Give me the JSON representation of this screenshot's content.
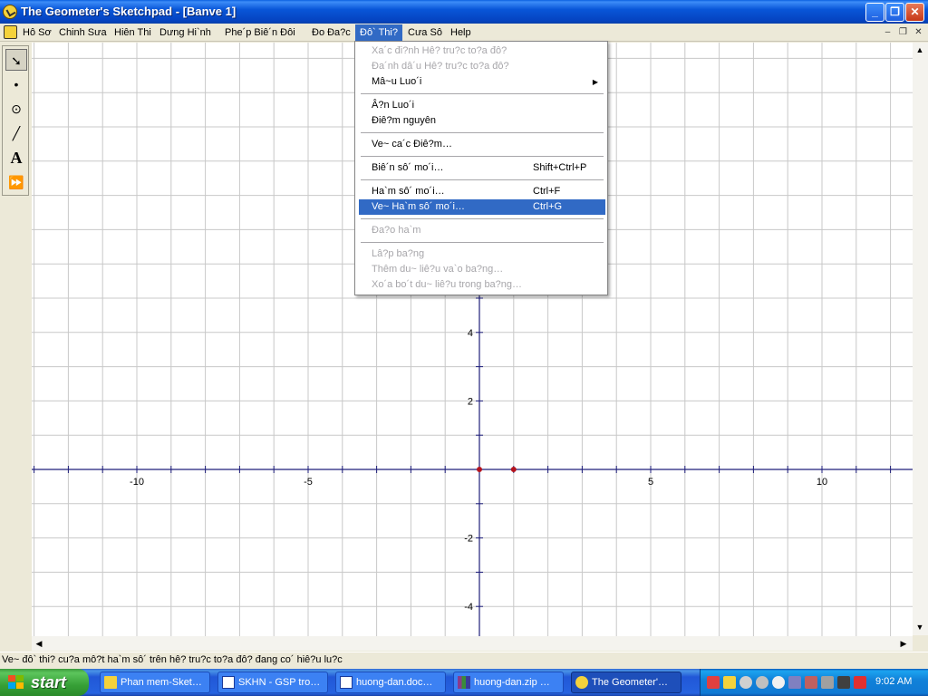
{
  "window": {
    "title": "The Geometer's Sketchpad - [Banve 1]",
    "minimize": "_",
    "maximize": "❐",
    "close": "✕"
  },
  "menubar": {
    "items": [
      "Hồ Sơ",
      "Chỉnh Sửa",
      "Hiển Thị",
      "Dựng Hình",
      "Phép Biến Đổi",
      "Đo Đạc",
      "Đồ Thị",
      "Cửa Sổ",
      "Help"
    ]
  },
  "menubar_labels": [
    "Hô Sơ",
    "Chinh Sưa",
    "Hiên Thi",
    "Dưng Hi`nh",
    "Phe´p Biê´n Đôi",
    "Đo Đa?c",
    "Đô` Thi?",
    "Cưa Sô",
    "Help"
  ],
  "dropdown": {
    "items": [
      {
        "label": "Xa´c đi?nh Hê? tru?c to?a đô?",
        "disabled": true
      },
      {
        "label": "Đa´nh dâ´u Hê? tru?c to?a đô?",
        "disabled": true
      },
      {
        "label": "Mâ~u Luo´i",
        "submenu": true
      },
      {
        "label": "Â?n Luo´i"
      },
      {
        "label": "Điê?m nguyên"
      },
      {
        "label": "Ve~ ca´c Điê?m…"
      },
      {
        "label": "Biê´n sô´ mo´i…",
        "shortcut": "Shift+Ctrl+P"
      },
      {
        "label": "Ha`m sô´ mo´i…",
        "shortcut": "Ctrl+F"
      },
      {
        "label": "Ve~ Ha`m sô´ mo´i…",
        "shortcut": "Ctrl+G",
        "highlighted": true
      },
      {
        "label": "Đa?o ha`m",
        "disabled": true
      },
      {
        "label": "Lâ?p ba?ng",
        "disabled": true
      },
      {
        "label": "Thêm du~ liê?u va`o ba?ng…",
        "disabled": true
      },
      {
        "label": "Xo´a bo´t du~ liê?u trong ba?ng…",
        "disabled": true
      }
    ]
  },
  "toolbox": {
    "tools": [
      {
        "name": "arrow-tool-icon",
        "glyph": "➘"
      },
      {
        "name": "point-tool-icon",
        "glyph": "•"
      },
      {
        "name": "compass-tool-icon",
        "glyph": "⊙"
      },
      {
        "name": "line-tool-icon",
        "glyph": "╱"
      },
      {
        "name": "text-tool-icon",
        "glyph": "A"
      },
      {
        "name": "custom-tool-icon",
        "glyph": "⏩"
      }
    ]
  },
  "chart_data": {
    "type": "scatter",
    "x_ticks": [
      -10,
      -5,
      5,
      10
    ],
    "y_ticks": [
      4,
      2,
      -2,
      -4
    ],
    "grid": true,
    "points": [
      {
        "x": 0,
        "y": 0
      },
      {
        "x": 1,
        "y": 0
      }
    ]
  },
  "status": {
    "text": "Ve~ đô` thi? cu?a mô?t ha`m sô´ trên hê? tru?c to?a đô? đang co´ hiê?u lu?c"
  },
  "taskbar": {
    "start_label": "start",
    "buttons": [
      {
        "label": "Phan mem-Sket…",
        "icon": "folder-icon"
      },
      {
        "label": "SKHN - GSP tro…",
        "icon": "word-icon"
      },
      {
        "label": "huong-dan.doc…",
        "icon": "word-icon"
      },
      {
        "label": "huong-dan.zip …",
        "icon": "zip-icon"
      },
      {
        "label": "The Geometer'…",
        "icon": "sketchpad-icon",
        "active": true
      }
    ],
    "clock": "9:02 AM"
  },
  "colors": {
    "axis": "#1E1E7A",
    "grid": "#C8C8C8",
    "point": "#B4141E",
    "highlight": "#316AC5"
  }
}
